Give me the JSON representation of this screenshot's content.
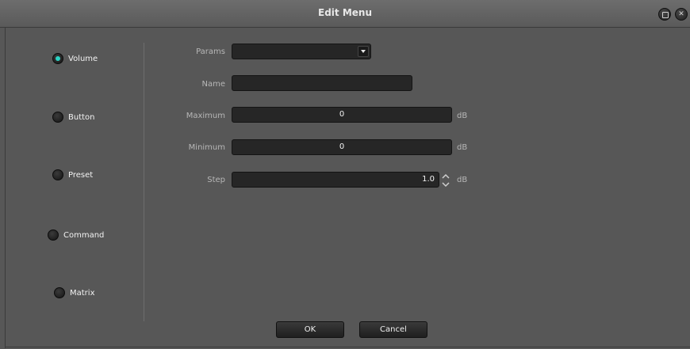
{
  "window": {
    "title": "Edit Menu"
  },
  "titlebar": {
    "restore_icon": "restore-icon",
    "close_icon": "close-icon",
    "close_glyph": "✕"
  },
  "types": [
    {
      "label": "Volume",
      "checked": true
    },
    {
      "label": "Button",
      "checked": false
    },
    {
      "label": "Preset",
      "checked": false
    },
    {
      "label": "Command",
      "checked": false
    },
    {
      "label": "Matrix",
      "checked": false
    }
  ],
  "form": {
    "params": {
      "label": "Params",
      "value": ""
    },
    "name": {
      "label": "Name",
      "value": ""
    },
    "maximum": {
      "label": "Maximum",
      "value": "0",
      "unit": "dB"
    },
    "minimum": {
      "label": "Minimum",
      "value": "0",
      "unit": "dB"
    },
    "step": {
      "label": "Step",
      "value": "1.0",
      "unit": "dB"
    }
  },
  "buttons": {
    "ok": "OK",
    "cancel": "Cancel"
  },
  "colors": {
    "accent": "#2bd3c4",
    "background": "#575757",
    "field": "#262626"
  }
}
